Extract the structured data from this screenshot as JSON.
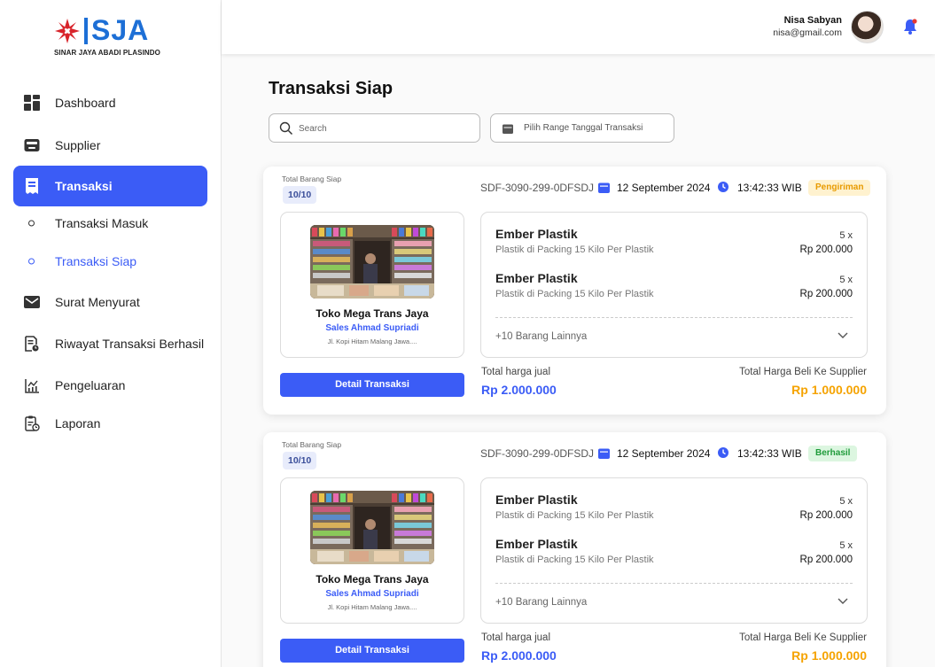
{
  "brand": {
    "name": "SJA",
    "tagline": "SINAR JAYA ABADI PLASINDO",
    "color": "#1d6fd6",
    "mark_color": "#d8232a"
  },
  "sidebar": {
    "items": [
      {
        "label": "Dashboard",
        "icon": "grid-icon"
      },
      {
        "label": "Supplier",
        "icon": "inbox-icon"
      },
      {
        "label": "Transaksi",
        "icon": "receipt-icon",
        "active": true
      },
      {
        "label": "Transaksi Masuk",
        "sub": true
      },
      {
        "label": "Transaksi Siap",
        "sub": true,
        "active": true
      },
      {
        "label": "Surat Menyurat",
        "icon": "mail-icon"
      },
      {
        "label": "Riwayat Transaksi Berhasil",
        "icon": "history-doc-icon"
      },
      {
        "label": "Pengeluaran",
        "icon": "chart-icon"
      },
      {
        "label": "Laporan",
        "icon": "report-icon"
      }
    ]
  },
  "header": {
    "user_name": "Nisa Sabyan",
    "user_email": "nisa@gmail.com"
  },
  "main": {
    "title": "Transaksi Siap",
    "search_placeholder": "Search",
    "date_range_placeholder": "Pilih Range Tanggal Transaksi"
  },
  "cards": [
    {
      "total_label": "Total Barang Siap",
      "total_value": "10/10",
      "code": "SDF-3090-299-0DFSDJ",
      "date": "12 September 2024",
      "time": "13:42:33 WIB",
      "status": "Pengiriman",
      "store_name": "Toko Mega Trans Jaya",
      "sales": "Sales Ahmad Supriadi",
      "address": "Jl. Kopi Hitam Malang Jawa....",
      "detail_button": "Detail Transaksi",
      "items": [
        {
          "name": "Ember Plastik",
          "desc": "Plastik di Packing 15 Kilo Per Plastik",
          "qty": "5 x",
          "price": "Rp 200.000"
        },
        {
          "name": "Ember Plastik",
          "desc": "Plastik di Packing 15 Kilo Per Plastik",
          "qty": "5 x",
          "price": "Rp 200.000"
        }
      ],
      "more": "+10 Barang Lainnya",
      "sell_label": "Total harga jual",
      "sell_value": "Rp 2.000.000",
      "buy_label": "Total Harga Beli Ke Supplier",
      "buy_value": "Rp 1.000.000"
    },
    {
      "total_label": "Total Barang Siap",
      "total_value": "10/10",
      "code": "SDF-3090-299-0DFSDJ",
      "date": "12 September 2024",
      "time": "13:42:33 WIB",
      "status": "Berhasil",
      "store_name": "Toko Mega Trans Jaya",
      "sales": "Sales Ahmad Supriadi",
      "address": "Jl. Kopi Hitam Malang Jawa....",
      "detail_button": "Detail Transaksi",
      "items": [
        {
          "name": "Ember Plastik",
          "desc": "Plastik di Packing 15 Kilo Per Plastik",
          "qty": "5 x",
          "price": "Rp 200.000"
        },
        {
          "name": "Ember Plastik",
          "desc": "Plastik di Packing 15 Kilo Per Plastik",
          "qty": "5 x",
          "price": "Rp 200.000"
        }
      ],
      "more": "+10 Barang Lainnya",
      "sell_label": "Total harga jual",
      "sell_value": "Rp 2.000.000",
      "buy_label": "Total Harga Beli Ke Supplier",
      "buy_value": "Rp 1.000.000"
    }
  ],
  "colors": {
    "primary": "#3b5cf6",
    "accent_orange": "#f5a300",
    "status_shipping_bg": "#fff2cf",
    "status_success_bg": "#dcf6e0"
  }
}
